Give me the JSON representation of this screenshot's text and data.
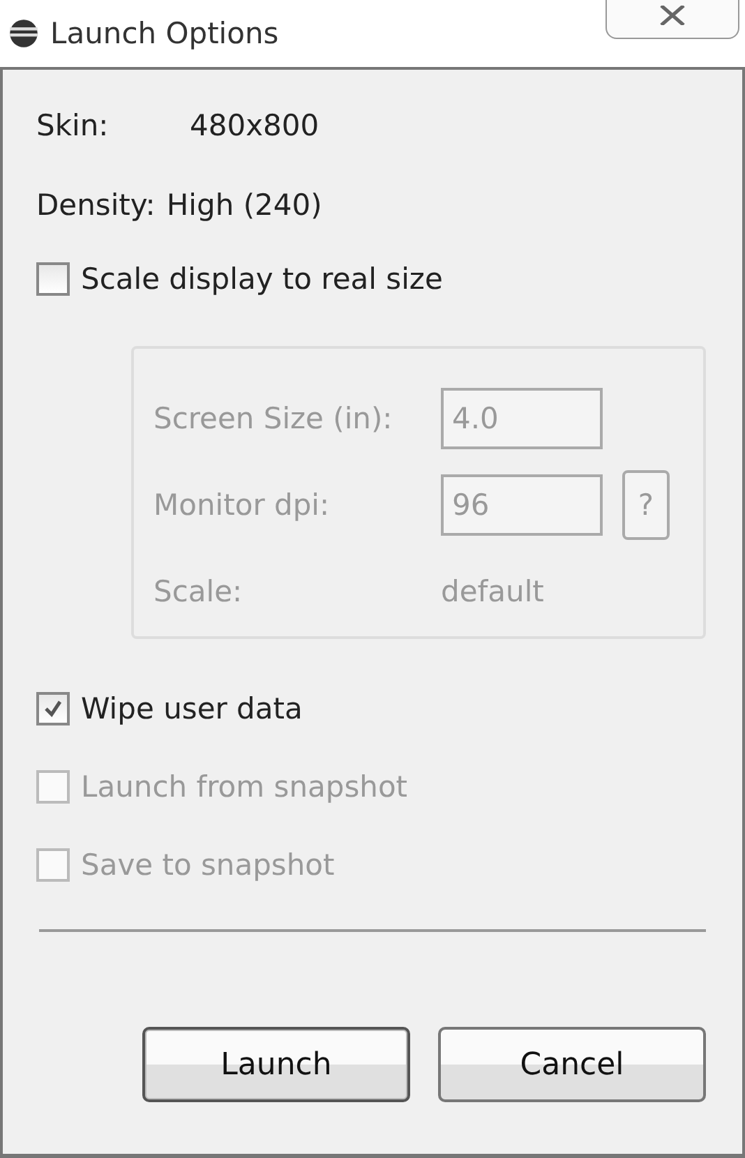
{
  "window": {
    "title": "Launch Options"
  },
  "info": [
    {
      "label": "Skin:",
      "value": "480x800"
    },
    {
      "label": "Density:",
      "value": "High (240)"
    }
  ],
  "scale_option": {
    "label": "Scale display to real size",
    "checked": false,
    "disabled": false
  },
  "scale_group": {
    "disabled": true,
    "screen_size": {
      "label": "Screen Size (in):",
      "value": "4.0"
    },
    "monitor_dpi": {
      "label": "Monitor dpi:",
      "value": "96",
      "help": "?"
    },
    "scale": {
      "label": "Scale:",
      "value": "default"
    }
  },
  "options": [
    {
      "label": "Wipe user data",
      "checked": true,
      "disabled": false
    },
    {
      "label": "Launch from snapshot",
      "checked": false,
      "disabled": true
    },
    {
      "label": "Save to snapshot",
      "checked": false,
      "disabled": true
    }
  ],
  "buttons": [
    {
      "label": "Launch",
      "kind": "default"
    },
    {
      "label": "Cancel",
      "kind": "normal"
    }
  ]
}
